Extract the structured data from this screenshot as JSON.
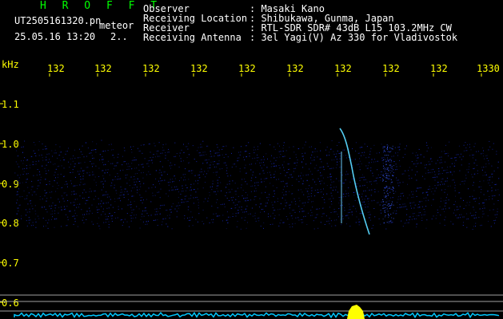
{
  "header": {
    "brand": "H R O F F T",
    "filename": "UT2505161320.pn",
    "event_type": "meteor",
    "timestamp": "25.05.16 13:20",
    "count": "2.."
  },
  "info": [
    {
      "label": "Observer",
      "value": ": Masaki Kano"
    },
    {
      "label": "Receiving Location",
      "value": ": Shibukawa, Gunma, Japan"
    },
    {
      "label": "Receiver",
      "value": ": RTL-SDR SDR# 43dB L15 103.2MHz CW"
    },
    {
      "label": "Receiving Antenna",
      "value": ": 3el Yagi(V) Az 330 for Vladivostok"
    }
  ],
  "axes": {
    "y_unit": "kHz",
    "x_ticks": [
      "132",
      "132",
      "132",
      "132",
      "132",
      "132",
      "132",
      "132",
      "132",
      "1330"
    ],
    "y_ticks": [
      "1.1",
      "1.0",
      "0.9",
      "0.8",
      "0.7",
      "0.6"
    ]
  },
  "colors": {
    "background": "#000000",
    "text": "#ffffff",
    "brand": "#00ff00",
    "axis_labels": "#ffff00",
    "noise": "#1a2cc8",
    "meteor_trail": "#58d8ff",
    "baseline": "#00c8ff",
    "peak": "#ffff00",
    "reference_lines": "#bdbdbd"
  }
}
